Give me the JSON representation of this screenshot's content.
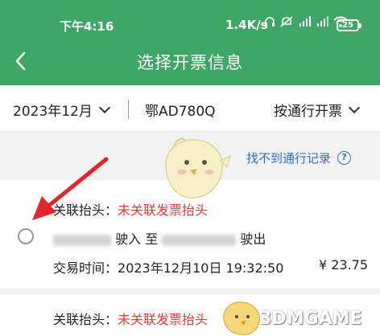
{
  "status_bar": {
    "time": "下午4:16",
    "network_speed": "1.4K/s",
    "battery": "25"
  },
  "header": {
    "title": "选择开票信息",
    "back_icon": "chevron-left-icon"
  },
  "filters": {
    "month": "2023年12月",
    "plate": "鄂AD780Q",
    "mode": "按通行开票"
  },
  "link": {
    "not_found": "找不到通行记录",
    "help_symbol": "?"
  },
  "records": [
    {
      "title_label": "关联抬头：",
      "title_value": "未关联发票抬头",
      "route_entry_suffix": "驶入",
      "route_to": "至",
      "route_exit_suffix": "驶出",
      "time_label": "交易时间：",
      "time_value": "2023年12月10日 19:32:50",
      "amount": "¥ 23.75"
    },
    {
      "title_label": "关联抬头：",
      "title_value": "未关联发票抬头"
    }
  ],
  "watermark": "3DMGAME",
  "colors": {
    "header_green": "#3ea765",
    "link_blue": "#2e6fcf",
    "warning_red": "#e53935",
    "arrow_red": "#e3262a"
  }
}
